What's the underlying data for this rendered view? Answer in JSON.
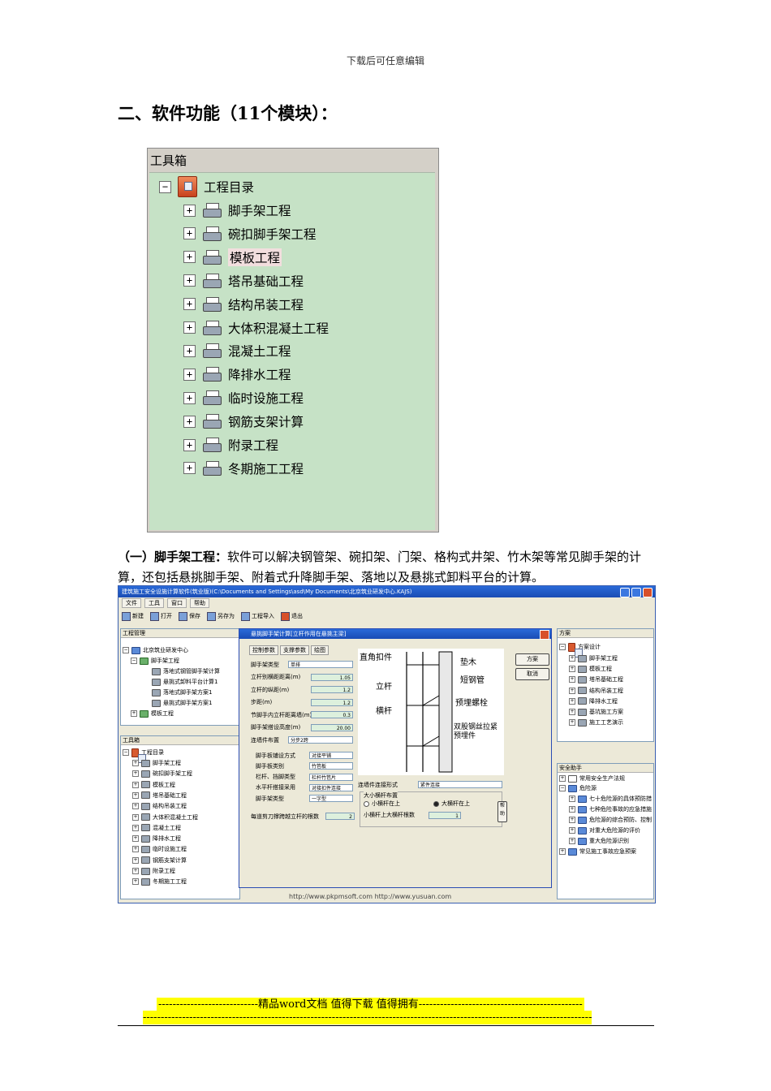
{
  "header": {
    "note": "下载后可任意编辑"
  },
  "section": {
    "title": "二、软件功能（11个模块）："
  },
  "toolbox": {
    "title": "工具箱",
    "root": "工程目录",
    "items": [
      "脚手架工程",
      "碗扣脚手架工程",
      "模板工程",
      "塔吊基础工程",
      "结构吊装工程",
      "大体积混凝土工程",
      "混凝土工程",
      "降排水工程",
      "临时设施工程",
      "钢筋支架计算",
      "附录工程",
      "冬期施工工程"
    ]
  },
  "paragraph": {
    "bold": "（一）脚手架工程：",
    "text": "软件可以解决钢管架、碗扣架、门架、格构式井架、竹木架等常见脚手架的计算，还包括悬挑脚手架、附着式升降脚手架、落地以及悬挑式卸料平台的计算。"
  },
  "app": {
    "title": "建筑施工安全设施计算软件(筑业版)(C:\\Documents and Settings\\asd\\My Documents\\北京筑业研发中心.KAJS)",
    "menu": [
      "文件",
      "工具",
      "窗口",
      "帮助"
    ],
    "toolbar": [
      "新建",
      "打开",
      "保存",
      "另存为",
      "工程导入",
      "退出"
    ],
    "left_top": {
      "header": "工程管理",
      "root": "北京筑业研发中心",
      "group": "脚手架工程",
      "children": [
        "落地式钢管脚手架计算",
        "悬挑式卸料平台计算1",
        "落地式脚手架方案1",
        "悬挑式脚手架方案1"
      ],
      "next": "模板工程"
    },
    "left_bottom": {
      "header": "工具箱",
      "root": "工程目录",
      "items": [
        "脚手架工程",
        "碗扣脚手架工程",
        "模板工程",
        "塔吊基础工程",
        "结构吊装工程",
        "大体积混凝土工程",
        "混凝土工程",
        "降排水工程",
        "临时设施工程",
        "钢筋支架计算",
        "附录工程",
        "冬期施工工程"
      ]
    },
    "dialog": {
      "title": "悬挑脚手架计算[立杆作用在悬挑主梁]",
      "tabs": [
        "控制参数",
        "支撑参数",
        "绘图"
      ],
      "rows": [
        {
          "label": "脚手架类型",
          "value": "单排"
        },
        {
          "label": "立杆别横距距离(m)",
          "value": "1.05"
        },
        {
          "label": "立杆的纵距(m)",
          "value": "1.2"
        },
        {
          "label": "步距(m)",
          "value": "1.2"
        },
        {
          "label": "节脚手内立杆距离墙(m)",
          "value": "0.3"
        },
        {
          "label": "脚手架搭设高度(m)",
          "value": "20.00"
        },
        {
          "label": "连墙件布置",
          "value": "分步2跨"
        }
      ],
      "rows2": [
        {
          "label": "脚手板铺设方式",
          "value": "对接平铺"
        },
        {
          "label": "脚手板类别",
          "value": "竹笆板"
        },
        {
          "label": "栏杆、挡脚类型",
          "value": "栏杆竹笆片"
        },
        {
          "label": "水平杆搭接采用",
          "value": "对接扣件连接"
        },
        {
          "label": "脚手架类型",
          "value": "一字型"
        }
      ],
      "scissor_label": "每道剪刀撑跨越立杆的根数",
      "scissor_value": "2",
      "buttons": [
        "方案",
        "取消"
      ],
      "drawing_labels": [
        "直角扣件",
        "垫木",
        "短钢管",
        "立杆",
        "预埋螺栓",
        "横杆",
        "双股钢丝拉紧预埋件"
      ],
      "connect_label": "连墙件连接形式",
      "connect_value": "紧件连接",
      "bar_title": "大小横杆布置",
      "radio1": "小横杆在上",
      "radio2": "大横杆在上",
      "bar_count_label": "小横杆上大横杆根数",
      "bar_count_value": "1",
      "help_btn": "帮助"
    },
    "right_top": {
      "header": "方案",
      "root": "方案设计",
      "items": [
        "脚手架工程",
        "模板工程",
        "塔吊基础工程",
        "结构吊装工程",
        "降排水工程",
        "基坑施工方案",
        "施工工艺演示"
      ]
    },
    "right_bottom": {
      "header": "安全助手",
      "items": [
        "常用安全生产法规",
        "危险源"
      ],
      "sub": [
        "七十危险源的具体预防措",
        "七种危险事故的应急措施",
        "危险源的综合预防、控制",
        "对重大危险源的评价",
        "重大危险源识别"
      ],
      "last": "常见施工事故应急预案"
    },
    "footer_url": "http://www.pkpmsoft.com   http://www.yusuan.com"
  },
  "footer": {
    "banner1": "----------------------------精品word文档 值得下载 值得拥有----------------------------------------------",
    "banner2": "------------------------------------------------------------------------------------------------------------------------------"
  }
}
